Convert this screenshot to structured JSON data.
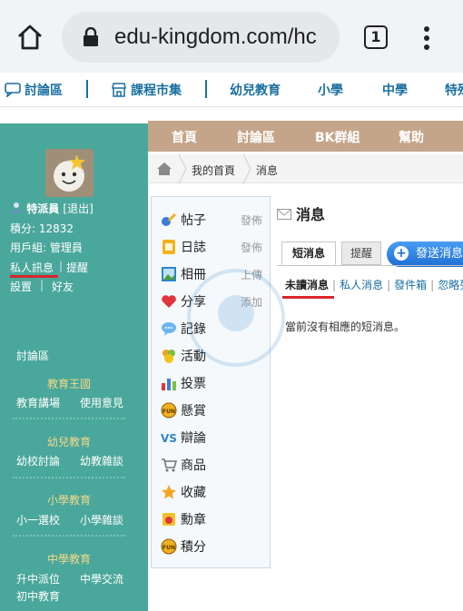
{
  "browser": {
    "url": "edu-kingdom.com/hc",
    "tab_count": "1"
  },
  "sitenav": {
    "items": [
      "討論區",
      "課程市集",
      "幼兒教育",
      "小學",
      "中學",
      "特殊"
    ]
  },
  "sidebar": {
    "username": "特派員",
    "logout": "[退出]",
    "points": "積分: 12832",
    "group": "用戶組: 管理員",
    "private_msg": "私人訊息",
    "remind": "提醒",
    "settings": "設置",
    "friends": "好友",
    "forum": "討論區",
    "sections": [
      {
        "head": "教育王國",
        "links": [
          "教育講場",
          "使用意見"
        ]
      },
      {
        "head": "幼兒教育",
        "links": [
          "幼校討論",
          "幼教雜談"
        ]
      },
      {
        "head": "小學教育",
        "links": [
          "小一選校",
          "小學雜談"
        ]
      },
      {
        "head": "中學教育",
        "links": [
          "升中派位",
          "中學交流",
          "初中教育"
        ]
      }
    ]
  },
  "maintabs": [
    "首頁",
    "討論區",
    "BK群組",
    "幫助"
  ],
  "breadcrumb": [
    "我的首頁",
    "消息"
  ],
  "menu": [
    {
      "label": "帖子",
      "action": "發佈",
      "icon": "post-icon"
    },
    {
      "label": "日誌",
      "action": "發佈",
      "icon": "diary-icon"
    },
    {
      "label": "相冊",
      "action": "上傳",
      "icon": "album-icon"
    },
    {
      "label": "分享",
      "action": "添加",
      "icon": "share-icon"
    },
    {
      "label": "記錄",
      "action": "",
      "icon": "record-icon"
    },
    {
      "label": "活動",
      "action": "",
      "icon": "activity-icon"
    },
    {
      "label": "投票",
      "action": "",
      "icon": "poll-icon"
    },
    {
      "label": "懸賞",
      "action": "",
      "icon": "reward-icon"
    },
    {
      "label": "辯論",
      "action": "",
      "icon": "debate-icon"
    },
    {
      "label": "商品",
      "action": "",
      "icon": "goods-icon"
    },
    {
      "label": "收藏",
      "action": "",
      "icon": "favorite-icon"
    },
    {
      "label": "勳章",
      "action": "",
      "icon": "medal-icon"
    },
    {
      "label": "積分",
      "action": "",
      "icon": "credit-icon"
    }
  ],
  "content": {
    "title": "消息",
    "tabs": [
      "短消息",
      "提醒"
    ],
    "send_button": "發送消息",
    "filters": [
      "未讀消息",
      "私人消息",
      "發件箱",
      "忽略列"
    ],
    "empty_message": "當前沒有相應的短消息。"
  },
  "colors": {
    "sidebar": "#4aa79b",
    "maintabs": "#c4a589",
    "link": "#1a6fa0",
    "highlight": "#d9262c"
  }
}
